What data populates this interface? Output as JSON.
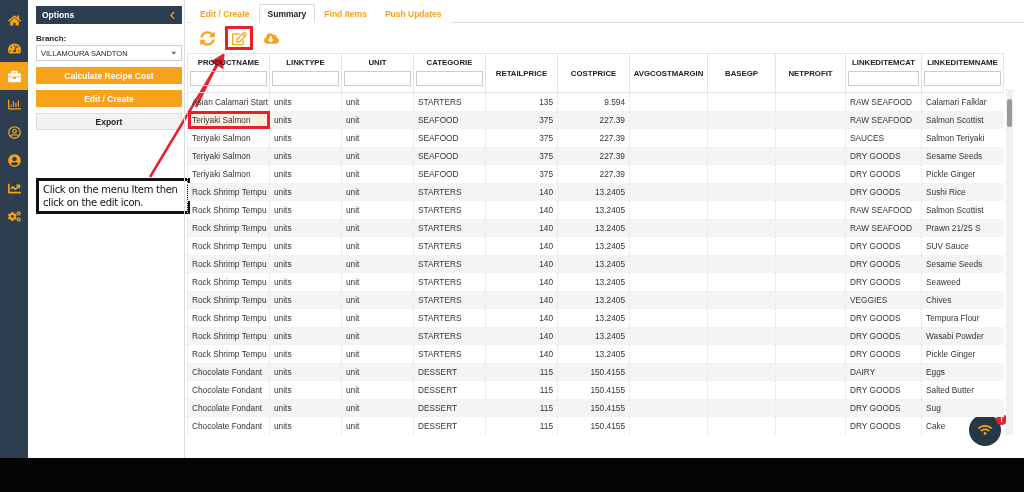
{
  "sidebar": {
    "items": [
      {
        "selected": false
      },
      {
        "selected": false
      },
      {
        "selected": true
      },
      {
        "selected": false
      },
      {
        "selected": false
      },
      {
        "selected": false
      },
      {
        "selected": false
      },
      {
        "selected": false
      }
    ]
  },
  "options": {
    "title": "Options",
    "branch_label": "Branch:",
    "branch_value": "VILLAMOURA SANDTON",
    "buttons": [
      {
        "label": "Calculate Recipe Cost",
        "kind": "primary"
      },
      {
        "label": "Edit / Create",
        "kind": "primary"
      },
      {
        "label": "Export",
        "kind": "secondary"
      }
    ]
  },
  "tabs": [
    {
      "label": "Edit / Create",
      "selected": false
    },
    {
      "label": "Summary",
      "selected": true
    },
    {
      "label": "Find Items",
      "selected": false
    },
    {
      "label": "Push Updates",
      "selected": false
    }
  ],
  "toolbar": [
    {
      "highlighted": false
    },
    {
      "highlighted": true
    },
    {
      "highlighted": false
    }
  ],
  "table": {
    "columns": [
      {
        "label": "PRODUCTNAME",
        "filter": true
      },
      {
        "label": "LINKTYPE",
        "filter": true
      },
      {
        "label": "UNIT",
        "filter": true
      },
      {
        "label": "CATEGORIE",
        "filter": true
      },
      {
        "label": "RETAILPRICE",
        "filter": false
      },
      {
        "label": "COSTPRICE",
        "filter": false
      },
      {
        "label": "AVGCOSTMARGIN",
        "filter": false
      },
      {
        "label": "BASEGP",
        "filter": false
      },
      {
        "label": "NETPROFIT",
        "filter": false
      },
      {
        "label": "LINKEDITEMCAT",
        "filter": true
      },
      {
        "label": "LINKEDITEMNAME",
        "filter": true
      }
    ],
    "rows": [
      {
        "selected": false,
        "cells": [
          "Asian Calamari Start",
          "units",
          "unit",
          "STARTERS",
          "135",
          "9.594",
          "",
          "",
          "",
          "RAW SEAFOOD",
          "Calamari Falklar"
        ]
      },
      {
        "selected": true,
        "cells": [
          "Teriyaki Salmon",
          "units",
          "unit",
          "SEAFOOD",
          "375",
          "227.39",
          "",
          "",
          "",
          "RAW SEAFOOD",
          "Salmon Scottist"
        ]
      },
      {
        "selected": false,
        "cells": [
          "Teriyaki Salmon",
          "units",
          "unit",
          "SEAFOOD",
          "375",
          "227.39",
          "",
          "",
          "",
          "SAUCES",
          "Salmon Teriyaki"
        ]
      },
      {
        "selected": false,
        "cells": [
          "Teriyaki Salmon",
          "units",
          "unit",
          "SEAFOOD",
          "375",
          "227.39",
          "",
          "",
          "",
          "DRY GOODS",
          "Sesame Seeds"
        ]
      },
      {
        "selected": false,
        "cells": [
          "Teriyaki Salmon",
          "units",
          "unit",
          "SEAFOOD",
          "375",
          "227.39",
          "",
          "",
          "",
          "DRY GOODS",
          "Pickle Ginger"
        ]
      },
      {
        "selected": false,
        "cells": [
          "Rock Shrimp Tempu",
          "units",
          "unit",
          "STARTERS",
          "140",
          "13.2405",
          "",
          "",
          "",
          "DRY GOODS",
          "Sushi Rice"
        ]
      },
      {
        "selected": false,
        "cells": [
          "Rock Shrimp Tempu",
          "units",
          "unit",
          "STARTERS",
          "140",
          "13.2405",
          "",
          "",
          "",
          "RAW SEAFOOD",
          "Salmon Scottist"
        ]
      },
      {
        "selected": false,
        "cells": [
          "Rock Shrimp Tempu",
          "units",
          "unit",
          "STARTERS",
          "140",
          "13.2405",
          "",
          "",
          "",
          "RAW SEAFOOD",
          "Prawn 21/25 S"
        ]
      },
      {
        "selected": false,
        "cells": [
          "Rock Shrimp Tempu",
          "units",
          "unit",
          "STARTERS",
          "140",
          "13.2405",
          "",
          "",
          "",
          "DRY GOODS",
          "SUV Sauce"
        ]
      },
      {
        "selected": false,
        "cells": [
          "Rock Shrimp Tempu",
          "units",
          "unit",
          "STARTERS",
          "140",
          "13.2405",
          "",
          "",
          "",
          "DRY GOODS",
          "Sesame Seeds"
        ]
      },
      {
        "selected": false,
        "cells": [
          "Rock Shrimp Tempu",
          "units",
          "unit",
          "STARTERS",
          "140",
          "13.2405",
          "",
          "",
          "",
          "DRY GOODS",
          "Seaweed"
        ]
      },
      {
        "selected": false,
        "cells": [
          "Rock Shrimp Tempu",
          "units",
          "unit",
          "STARTERS",
          "140",
          "13.2405",
          "",
          "",
          "",
          "VEGGIES",
          "Chives"
        ]
      },
      {
        "selected": false,
        "cells": [
          "Rock Shrimp Tempu",
          "units",
          "unit",
          "STARTERS",
          "140",
          "13.2405",
          "",
          "",
          "",
          "DRY GOODS",
          "Tempura Flour"
        ]
      },
      {
        "selected": false,
        "cells": [
          "Rock Shrimp Tempu",
          "units",
          "unit",
          "STARTERS",
          "140",
          "13.2405",
          "",
          "",
          "",
          "DRY GOODS",
          "Wasabi Powder"
        ]
      },
      {
        "selected": false,
        "cells": [
          "Rock Shrimp Tempu",
          "units",
          "unit",
          "STARTERS",
          "140",
          "13.2405",
          "",
          "",
          "",
          "DRY GOODS",
          "Pickle Ginger"
        ]
      },
      {
        "selected": false,
        "cells": [
          "Chocolate Fondant",
          "units",
          "unit",
          "DESSERT",
          "115",
          "150.4155",
          "",
          "",
          "",
          "DAIRY",
          "Eggs"
        ]
      },
      {
        "selected": false,
        "cells": [
          "Chocolate Fondant",
          "units",
          "unit",
          "DESSERT",
          "115",
          "150.4155",
          "",
          "",
          "",
          "DRY GOODS",
          "Salted Butter"
        ]
      },
      {
        "selected": false,
        "cells": [
          "Chocolate Fondant",
          "units",
          "unit",
          "DESSERT",
          "115",
          "150.4155",
          "",
          "",
          "",
          "DRY GOODS",
          "Sug"
        ]
      },
      {
        "selected": false,
        "cells": [
          "Chocolate Fondant",
          "units",
          "unit",
          "DESSERT",
          "115",
          "150.4155",
          "",
          "",
          "",
          "DRY GOODS",
          "Cake"
        ]
      }
    ]
  },
  "callout": {
    "text": "Click on the menu Item then click on the edit icon."
  },
  "chat_button": {
    "badge": "!"
  }
}
